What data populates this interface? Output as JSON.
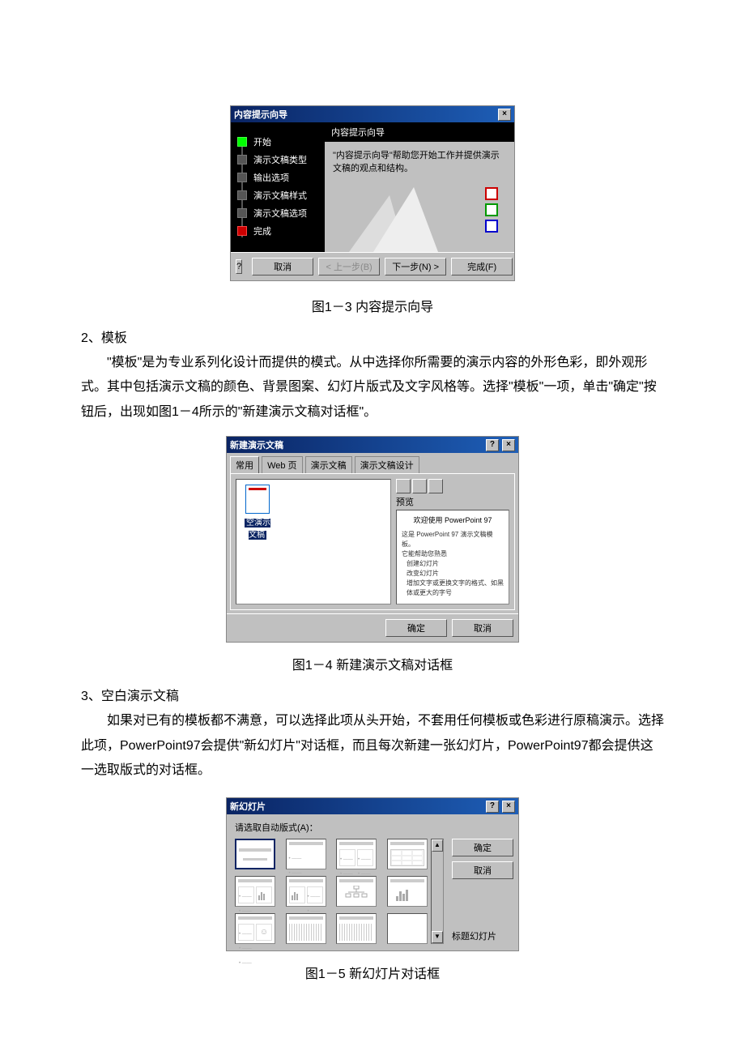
{
  "wizard": {
    "title": "内容提示向导",
    "close": "×",
    "nav": [
      "开始",
      "演示文稿类型",
      "输出选项",
      "演示文稿样式",
      "演示文稿选项",
      "完成"
    ],
    "banner": "内容提示向导",
    "text": "\"内容提示向导\"帮助您开始工作并提供演示文稿的观点和结构。",
    "help": "?",
    "btn_cancel": "取消",
    "btn_back": "< 上一步(B)",
    "btn_next": "下一步(N) >",
    "btn_finish": "完成(F)"
  },
  "captions": {
    "c1": "图1－3 内容提示向导",
    "c2": "图1－4 新建演示文稿对话框",
    "c3": "图1－5 新幻灯片对话框"
  },
  "text": {
    "n2": "2、模板",
    "p2": "\"模板\"是为专业系列化设计而提供的模式。从中选择你所需要的演示内容的外形色彩，即外观形式。其中包括演示文稿的颜色、背景图案、幻灯片版式及文字风格等。选择\"模板\"一项，单击\"确定\"按钮后，出现如图1－4所示的\"新建演示文稿对话框\"。",
    "n3": "3、空白演示文稿",
    "p3": "如果对已有的模板都不满意，可以选择此项从头开始，不套用任何模板或色彩进行原稿演示。选择此项，PowerPoint97会提供\"新幻灯片\"对话框，而且每次新建一张幻灯片，PowerPoint97都会提供这一选取版式的对话框。"
  },
  "newdlg": {
    "title": "新建演示文稿",
    "help": "?",
    "close": "×",
    "tabs": [
      "常用",
      "Web 页",
      "演示文稿",
      "演示文稿设计"
    ],
    "file": "空演示文稿",
    "preview_label": "预览",
    "preview_title": "欢迎使用 PowerPoint 97",
    "preview_bullets": [
      "这是 PowerPoint 97 演示文稿模板。",
      "它能帮助您熟悉",
      " 创建幻灯片",
      " 改变幻灯片",
      " 增加文字或更换文字的格式、如黑体或更大的字号"
    ],
    "ok": "确定",
    "cancel": "取消"
  },
  "slidedlg": {
    "title": "新幻灯片",
    "help": "?",
    "close": "×",
    "label": "请选取自动版式(A)：",
    "ok": "确定",
    "cancel": "取消",
    "name": "标题幻灯片",
    "scroll_up": "▲",
    "scroll_down": "▼"
  }
}
